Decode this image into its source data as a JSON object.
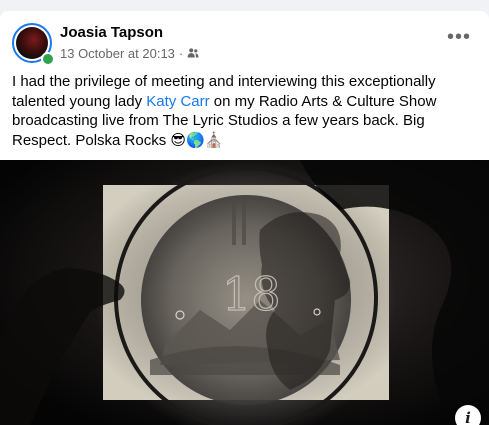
{
  "post": {
    "author": "Joasia Tapson",
    "timestamp": "13 October at 20:13",
    "separator": "·",
    "audience_icon": "friends-icon",
    "more_label": "•••",
    "text_before_link": "I had the privilege of meeting and interviewing this exceptionally talented young lady ",
    "link_text": "Katy Carr",
    "text_after_link": " on my Radio Arts & Culture Show broadcasting live from The Lyric Studios a few years back. Big Respect. Polska Rocks 😎🌎⛪",
    "media_overlay_number": "18",
    "info_label": "i"
  },
  "colors": {
    "link": "#1877f2",
    "secondary_text": "#65676b",
    "online": "#31a24c"
  }
}
